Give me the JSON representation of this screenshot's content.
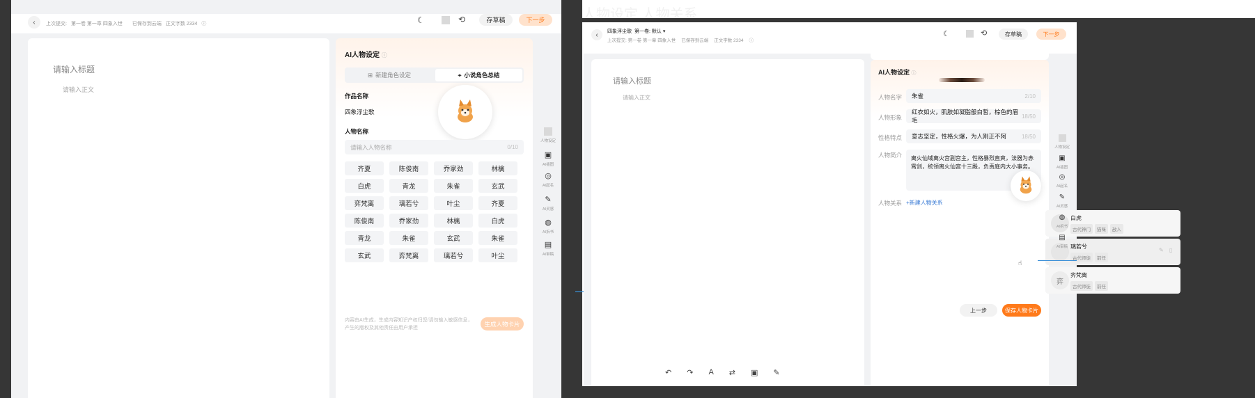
{
  "left": {
    "header": {
      "meta": [
        "上次提交:",
        "第一卷 第一章 四象入世",
        "已保存到云端",
        "正文字数 2334"
      ],
      "save_draft": "存草稿",
      "next_step": "下一步"
    },
    "editor": {
      "title_placeholder": "请输入标题",
      "body_placeholder": "请输入正文"
    },
    "panel": {
      "title": "AI人物设定",
      "tabs": [
        "新建角色设定",
        "小说角色总结"
      ],
      "work_label": "作品名称",
      "work_value": "四象浮尘歌",
      "person_label": "人物名称",
      "person_placeholder": "请输入人物名称",
      "person_count": "0/10",
      "names": [
        "齐夏",
        "陈俊南",
        "乔家劲",
        "林檎",
        "白虎",
        "青龙",
        "朱雀",
        "玄武",
        "弈梵离",
        "璃若兮",
        "叶尘",
        "齐夏",
        "陈俊南",
        "乔家劲",
        "林檎",
        "白虎",
        "青龙",
        "朱雀",
        "玄武",
        "朱雀",
        "玄武",
        "弈梵离",
        "璃若兮",
        "叶尘"
      ],
      "footer_note_1": "内容由AI生成，生成内容知识产权归您/请勿输入敏感信息，",
      "footer_note_2": "产生的版权及其他责任由用户承担",
      "generate_btn": "生成人物卡片"
    },
    "rail": [
      "人物设定",
      "AI插图",
      "AI起名",
      "AI灵感",
      "AI拆书",
      "AI审稿"
    ]
  },
  "right": {
    "overlay_title": "人物设定 人物关系",
    "header": {
      "book": "四象浮尘歌",
      "volume": "第一卷: 默认 ▾",
      "meta": [
        "上次提交: 第一卷 第一章 四象入世",
        "已保存到云端",
        "正文字数 2334"
      ],
      "save_draft": "存草稿",
      "next_step": "下一步"
    },
    "editor": {
      "title_placeholder": "请输入标题",
      "body_placeholder": "请输入正文"
    },
    "panel": {
      "title": "AI人物设定",
      "name_label": "人物名字",
      "name_value": "朱雀",
      "name_count": "2/10",
      "image_label": "人物形象",
      "image_value": "红衣如火，肌肤如凝脂般白皙，棕色的眉毛",
      "image_count": "18/50",
      "trait_label": "性格特点",
      "trait_value": "意志坚定，性格火爆，为人刚正不阿",
      "trait_count": "18/50",
      "intro_label": "人物简介",
      "intro_value": "离火仙域离火宫副宫主，性格暴烈直爽，法器为赤霄剑，统领离火仙宫十三殿，负责庭内大小事务。",
      "relation_label": "人物关系",
      "relation_add": "+新建人物关系",
      "relations": [
        {
          "name": "白虎",
          "tags": [
            "古代神门",
            "猫咪",
            "敌人"
          ],
          "avatar": ""
        },
        {
          "name": "璃若兮",
          "tags": [
            "古代师徒",
            "前任"
          ],
          "avatar": ""
        },
        {
          "name": "弈梵离",
          "tags": [
            "古代师徒",
            "前任"
          ],
          "avatar": "弈"
        }
      ],
      "prev_btn": "上一步",
      "save_btn": "保存人物卡片"
    },
    "rail": [
      "人物设定",
      "AI插图",
      "AI起名",
      "AI灵感",
      "AI拆书",
      "AI审稿"
    ]
  },
  "colors": {
    "accent": "#ff7a1a",
    "accent_soft": "#ffd6b8",
    "dark": "#363636"
  }
}
